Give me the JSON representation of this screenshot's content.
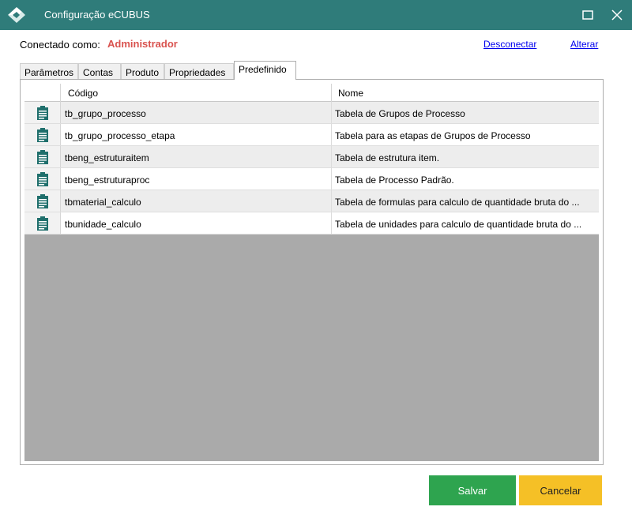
{
  "window": {
    "title": "Configuração eCUBUS"
  },
  "connection": {
    "label": "Conectado como:",
    "user": "Administrador",
    "disconnect": "Desconectar",
    "alter": "Alterar"
  },
  "tabs": [
    {
      "label": "Parâmetros"
    },
    {
      "label": "Contas"
    },
    {
      "label": "Produto"
    },
    {
      "label": "Propriedades"
    },
    {
      "label": "Predefinido"
    }
  ],
  "grid": {
    "columns": {
      "code": "Código",
      "name": "Nome"
    },
    "rows": [
      {
        "code": "tb_grupo_processo",
        "name": "Tabela de Grupos de Processo"
      },
      {
        "code": "tb_grupo_processo_etapa",
        "name": "Tabela para as etapas de Grupos de Processo"
      },
      {
        "code": "tbeng_estruturaitem",
        "name": "Tabela de estrutura item."
      },
      {
        "code": "tbeng_estruturaproc",
        "name": "Tabela de Processo Padrão."
      },
      {
        "code": "tbmaterial_calculo",
        "name": "Tabela de formulas para calculo de quantidade bruta do ..."
      },
      {
        "code": "tbunidade_calculo",
        "name": "Tabela de unidades para calculo de quantidade bruta do ..."
      }
    ]
  },
  "buttons": {
    "save": "Salvar",
    "cancel": "Cancelar"
  },
  "icons": {
    "app": "ecubus-logo-icon",
    "row": "clipboard-icon",
    "maximize": "maximize-icon",
    "close": "close-icon"
  },
  "colors": {
    "titlebar": "#2f7c7a",
    "user": "#d9534f",
    "save": "#2ea44f",
    "cancel": "#f5c026",
    "icon": "#1f6f6c"
  }
}
